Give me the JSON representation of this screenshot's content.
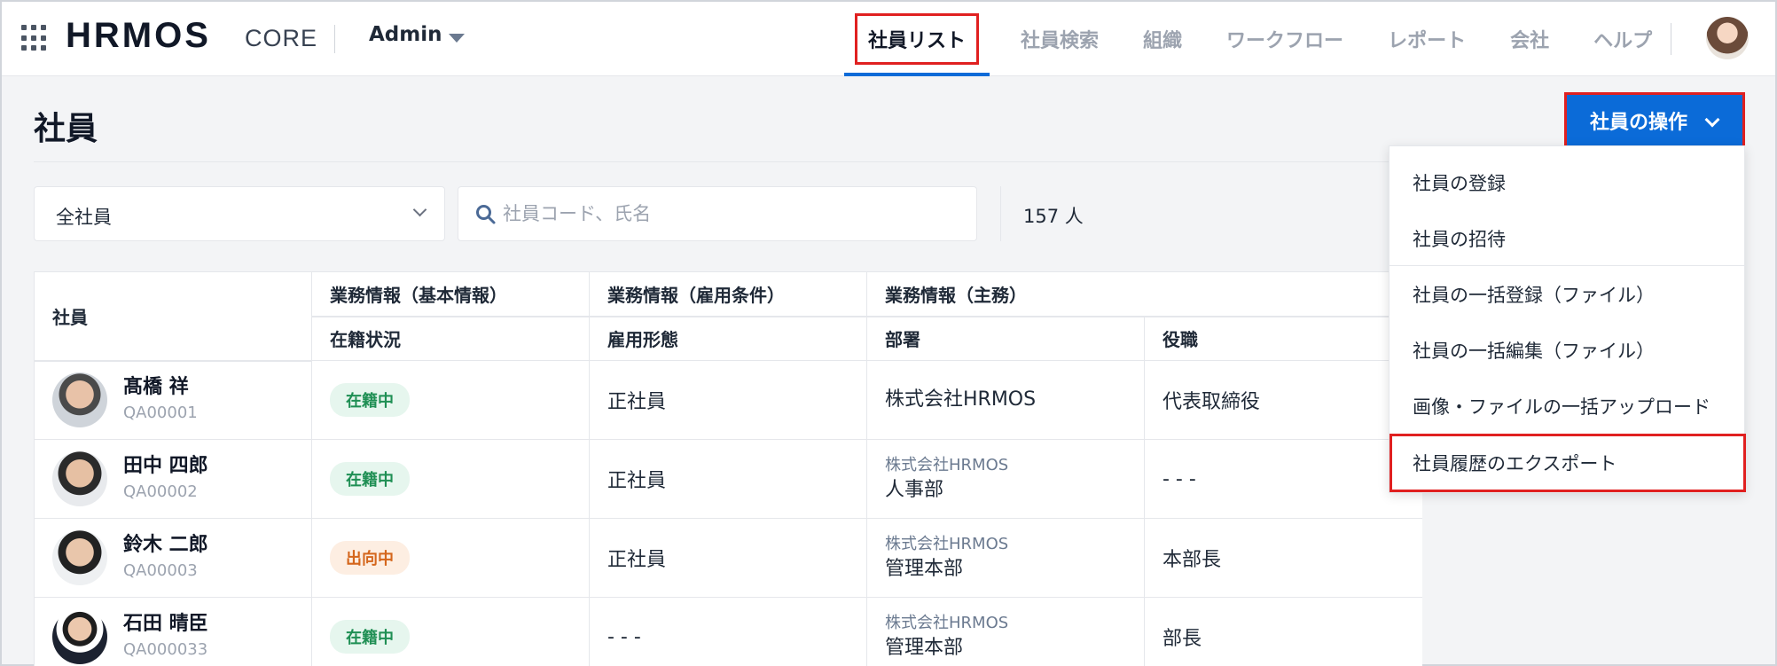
{
  "header": {
    "logo": "HRMOS",
    "product": "CORE",
    "role": "Admin",
    "nav": [
      {
        "label": "社員リスト",
        "active": true
      },
      {
        "label": "社員検索"
      },
      {
        "label": "組織"
      },
      {
        "label": "ワークフロー"
      },
      {
        "label": "レポート"
      },
      {
        "label": "会社"
      },
      {
        "label": "ヘルプ"
      }
    ]
  },
  "page": {
    "title": "社員",
    "ops_button": "社員の操作"
  },
  "filters": {
    "selected": "全社員",
    "search_placeholder": "社員コード、氏名",
    "count": "157 人"
  },
  "table": {
    "col_employee": "社員",
    "groups": [
      "業務情報（基本情報）",
      "業務情報（雇用条件）",
      "業務情報（主務）"
    ],
    "sub_headers": [
      "在籍状況",
      "雇用形態",
      "部署",
      "役職"
    ],
    "rows": [
      {
        "name": "髙橋 祥",
        "code": "QA00001",
        "status": "在籍中",
        "employment": "正社員",
        "dept_parent": "",
        "dept": "株式会社HRMOS",
        "title": "代表取締役"
      },
      {
        "name": "田中 四郎",
        "code": "QA00002",
        "status": "在籍中",
        "employment": "正社員",
        "dept_parent": "株式会社HRMOS",
        "dept": "人事部",
        "title": "- - -"
      },
      {
        "name": "鈴木 二郎",
        "code": "QA00003",
        "status": "出向中",
        "employment": "正社員",
        "dept_parent": "株式会社HRMOS",
        "dept": "管理本部",
        "title": "本部長"
      },
      {
        "name": "石田 晴臣",
        "code": "QA000033",
        "status": "在籍中",
        "employment": "- - -",
        "dept_parent": "株式会社HRMOS",
        "dept": "管理本部",
        "title": "部長"
      }
    ]
  },
  "menu": {
    "items": [
      "社員の登録",
      "社員の招待",
      "社員の一括登録（ファイル）",
      "社員の一括編集（ファイル）",
      "画像・ファイルの一括アップロード",
      "社員履歴のエクスポート"
    ]
  },
  "colors": {
    "accent": "#0b6bd8",
    "highlight": "#e02020",
    "status_green": "#1f8f54",
    "status_orange": "#d4661c"
  }
}
